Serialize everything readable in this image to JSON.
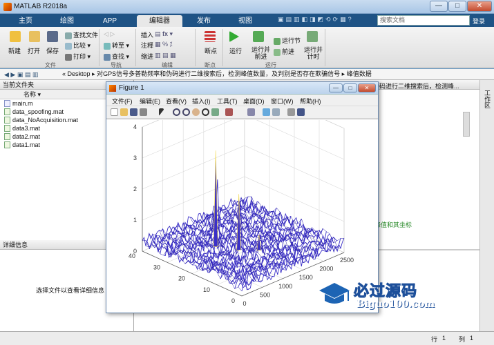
{
  "window": {
    "title": "MATLAB R2018a",
    "min": "—",
    "max": "□",
    "close": "✕"
  },
  "tabs": [
    "主页",
    "绘图",
    "APP",
    "编辑器",
    "发布",
    "视图"
  ],
  "search_placeholder": "搜索文档",
  "login": "登录",
  "ribbon": {
    "new": "新建",
    "open": "打开",
    "save": "保存",
    "find_files": "查找文件",
    "compare": "比较",
    "print": "打印",
    "goto": "转至",
    "find": "查找",
    "insert": "插入",
    "comment": "注释",
    "indent": "缩进",
    "fx": "fx",
    "breakpoints": "断点",
    "run": "运行",
    "run_advance": "运行并\n前进",
    "run_section": "运行节",
    "advance": "前进",
    "run_time": "运行并\n计时",
    "sections": [
      "文件",
      "导航",
      "编辑",
      "断点",
      "运行"
    ]
  },
  "address": {
    "path": [
      "«",
      "Desktop",
      "▸",
      "对GPS信号多普勒频率和伪码进行二维搜索后，检测峰值数量，及判别是否存在欺骗信号",
      "▸",
      "峰值数据"
    ]
  },
  "current_folder": {
    "header": "当前文件夹",
    "col": "名称 ▾",
    "files": [
      "main.m",
      "data_spoofing.mat",
      "data_NoAcquisition.mat",
      "data3.mat",
      "data2.mat",
      "data1.mat"
    ]
  },
  "details": {
    "header": "详细信息",
    "hint": "选择文件以查看详细信息"
  },
  "editor_fragment": {
    "top": "伪码进行二维搜索后，检测峰...",
    "mid": "峰值和其坐标"
  },
  "workspace_label": "工作区",
  "status": {
    "line_label": "行",
    "line": "1",
    "col_label": "列",
    "col": "1"
  },
  "figure": {
    "title": "Figure 1",
    "menus": [
      "文件(F)",
      "编辑(E)",
      "查看(V)",
      "插入(I)",
      "工具(T)",
      "桌面(D)",
      "窗口(W)",
      "帮助(H)"
    ]
  },
  "chart_data": {
    "type": "surface",
    "title": "",
    "z_multiplier": "× 10⁵",
    "z_ticks": [
      "0",
      "1",
      "2",
      "3",
      "4"
    ],
    "x_ticks": [
      "0",
      "500",
      "1000",
      "1500",
      "2000",
      "2500"
    ],
    "y_ticks": [
      "0",
      "10",
      "20",
      "30",
      "40"
    ],
    "xlim": [
      0,
      2500
    ],
    "ylim": [
      0,
      40
    ],
    "zlim": [
      0,
      400000
    ],
    "noise_level": 40000,
    "peaks": [
      {
        "x": 700,
        "y": 22,
        "z": 350000
      },
      {
        "x": 900,
        "y": 16,
        "z": 220000
      },
      {
        "x": 1150,
        "y": 12,
        "z": 90000
      }
    ],
    "surface_color": "#3a2fc8",
    "peak_color": "#f2d84a"
  },
  "watermark": {
    "brand": "必过源码",
    "url": "Biguo100.com"
  }
}
